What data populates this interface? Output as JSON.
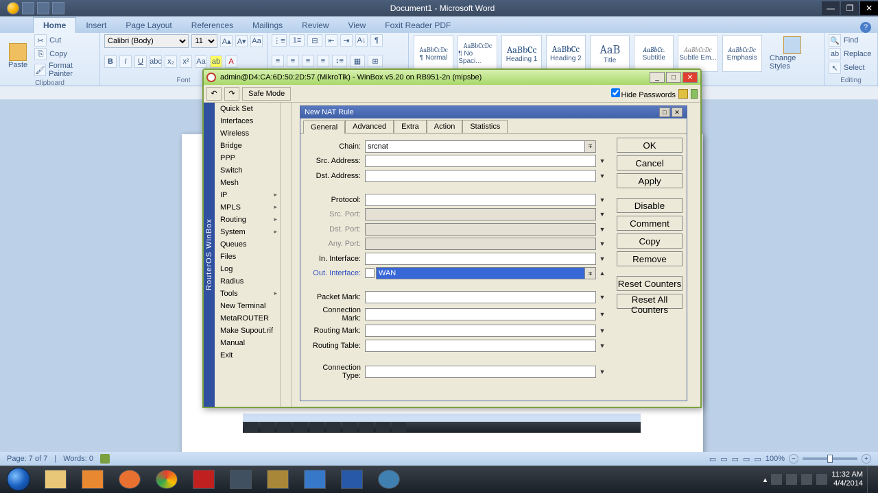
{
  "word": {
    "title": "Document1 - Microsoft Word",
    "tabs": [
      "Home",
      "Insert",
      "Page Layout",
      "References",
      "Mailings",
      "Review",
      "View",
      "Foxit Reader PDF"
    ],
    "clipboard": {
      "paste": "Paste",
      "cut": "Cut",
      "copy": "Copy",
      "format_painter": "Format Painter",
      "group": "Clipboard"
    },
    "font": {
      "name": "Calibri (Body)",
      "size": "11",
      "group": "Font"
    },
    "styles": [
      "¶ Normal",
      "¶ No Spaci...",
      "Heading 1",
      "Heading 2",
      "Title",
      "Subtitle",
      "Subtle Em...",
      "Emphasis"
    ],
    "style_sample": "AaBbCcDc",
    "change_styles": "Change Styles",
    "editing": {
      "find": "Find",
      "replace": "Replace",
      "select": "Select",
      "group": "Editing"
    },
    "status": {
      "page": "Page: 7 of 7",
      "words": "Words: 0",
      "zoom": "100%"
    }
  },
  "winbox": {
    "title": "admin@D4:CA:6D:50:2D:57 (MikroTik) - WinBox v5.20 on RB951-2n (mipsbe)",
    "safe_mode": "Safe Mode",
    "hide_passwords": "Hide Passwords",
    "vertical": "RouterOS WinBox",
    "menu": [
      "Quick Set",
      "Interfaces",
      "Wireless",
      "Bridge",
      "PPP",
      "Switch",
      "Mesh",
      "IP",
      "MPLS",
      "Routing",
      "System",
      "Queues",
      "Files",
      "Log",
      "Radius",
      "Tools",
      "New Terminal",
      "MetaROUTER",
      "Make Supout.rif",
      "Manual",
      "Exit"
    ],
    "menu_arrows": [
      7,
      8,
      9,
      10,
      15
    ]
  },
  "nat": {
    "title": "New NAT Rule",
    "tabs": [
      "General",
      "Advanced",
      "Extra",
      "Action",
      "Statistics"
    ],
    "fields": {
      "chain": {
        "label": "Chain:",
        "value": "srcnat"
      },
      "src_addr": {
        "label": "Src. Address:"
      },
      "dst_addr": {
        "label": "Dst. Address:"
      },
      "protocol": {
        "label": "Protocol:"
      },
      "src_port": {
        "label": "Src. Port:"
      },
      "dst_port": {
        "label": "Dst. Port:"
      },
      "any_port": {
        "label": "Any. Port:"
      },
      "in_if": {
        "label": "In. Interface:"
      },
      "out_if": {
        "label": "Out. Interface:",
        "value": "WAN"
      },
      "pkt_mark": {
        "label": "Packet Mark:"
      },
      "conn_mark": {
        "label": "Connection Mark:"
      },
      "route_mark": {
        "label": "Routing Mark:"
      },
      "route_table": {
        "label": "Routing Table:"
      },
      "conn_type": {
        "label": "Connection Type:"
      }
    },
    "buttons": {
      "ok": "OK",
      "cancel": "Cancel",
      "apply": "Apply",
      "disable": "Disable",
      "comment": "Comment",
      "copy": "Copy",
      "remove": "Remove",
      "reset": "Reset Counters",
      "reset_all": "Reset All Counters"
    }
  },
  "taskbar": {
    "time": "11:32 AM",
    "date": "4/4/2014"
  }
}
